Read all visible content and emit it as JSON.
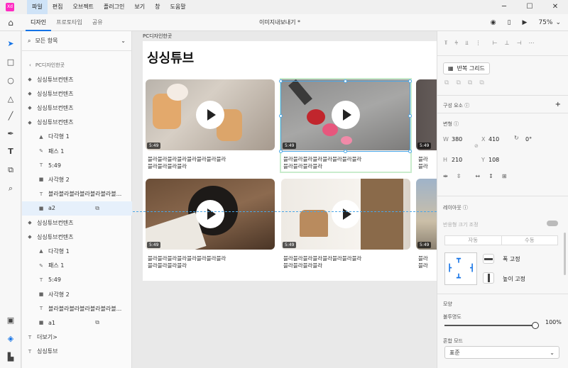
{
  "menu": [
    "파일",
    "편집",
    "오브젝트",
    "플러그인",
    "보기",
    "창",
    "도움말"
  ],
  "window_controls": [
    "─",
    "☐",
    "✕"
  ],
  "tabs": [
    "디자인",
    "프로토타입",
    "공유"
  ],
  "doc_title": "이미지내보내기 *",
  "zoom": "75%",
  "layers": {
    "search_label": "모든 항목",
    "breadcrumb": "PC디자인한곳",
    "items": [
      {
        "label": "싱싱튜브컨텐츠",
        "icon": "component-icon"
      },
      {
        "label": "싱싱튜브컨텐츠",
        "icon": "component-icon"
      },
      {
        "label": "싱싱튜브컨텐츠",
        "icon": "component-icon"
      },
      {
        "label": "싱싱튜브컨텐츠",
        "icon": "component-icon"
      },
      {
        "label": "다각형 1",
        "icon": "triangle-icon"
      },
      {
        "label": "패스 1",
        "icon": "pen-icon"
      },
      {
        "label": "5:49",
        "icon": "text-icon"
      },
      {
        "label": "사각형 2",
        "icon": "rect-icon"
      },
      {
        "label": "블라블라블라블라블라블라블...",
        "icon": "text-icon"
      },
      {
        "label": "a2",
        "icon": "rect-icon"
      },
      {
        "label": "싱싱튜브컨텐츠",
        "icon": "component-icon"
      },
      {
        "label": "싱싱튜브컨텐츠",
        "icon": "component-icon"
      },
      {
        "label": "다각형 1",
        "icon": "triangle-icon"
      },
      {
        "label": "패스 1",
        "icon": "pen-icon"
      },
      {
        "label": "5:49",
        "icon": "text-icon"
      },
      {
        "label": "사각형 2",
        "icon": "rect-icon"
      },
      {
        "label": "블라블라블라블라블라블라블...",
        "icon": "text-icon"
      },
      {
        "label": "a1",
        "icon": "rect-icon"
      },
      {
        "label": "더보기>",
        "icon": "text-icon"
      },
      {
        "label": "싱싱튜브",
        "icon": "text-icon"
      }
    ]
  },
  "canvas": {
    "artboard_label": "PC디자인한곳",
    "page_title": "싱싱튜브",
    "cards": [
      {
        "duration": "5:49",
        "desc1": "블라블라블라블라블라블라블라블라",
        "desc2": "블라블라블라블라"
      },
      {
        "duration": "5:49",
        "desc1": "블라블라블라블라블라블라블라블라",
        "desc2": "블라블라블라블라"
      },
      {
        "duration": "5:49",
        "desc1": "블라",
        "desc2": "블라"
      },
      {
        "duration": "5:49",
        "desc1": "블라블라블라블라블라블라블라블라",
        "desc2": "블라블라블라블라"
      },
      {
        "duration": "5:49",
        "desc1": "블라블라블라블라블라블라블라블라",
        "desc2": "블라블라블라블라"
      },
      {
        "duration": "5:49",
        "desc1": "블라",
        "desc2": "블라"
      }
    ]
  },
  "props": {
    "repeat_grid": "반복 그리드",
    "components": "구성 요소",
    "transform": "변형",
    "w_label": "W",
    "w": "380",
    "x_label": "X",
    "x": "410",
    "rot": "0°",
    "h_label": "H",
    "h": "210",
    "y_label": "Y",
    "y": "108",
    "layout": "레이아웃",
    "responsive": "반응형 크기 조정",
    "auto": "자동",
    "manual": "수동",
    "fix_width": "폭 고정",
    "fix_height": "높이 고정",
    "appearance": "모양",
    "opacity_label": "불투명도",
    "opacity": "100%",
    "blend_label": "혼합 모드",
    "blend": "표준"
  }
}
